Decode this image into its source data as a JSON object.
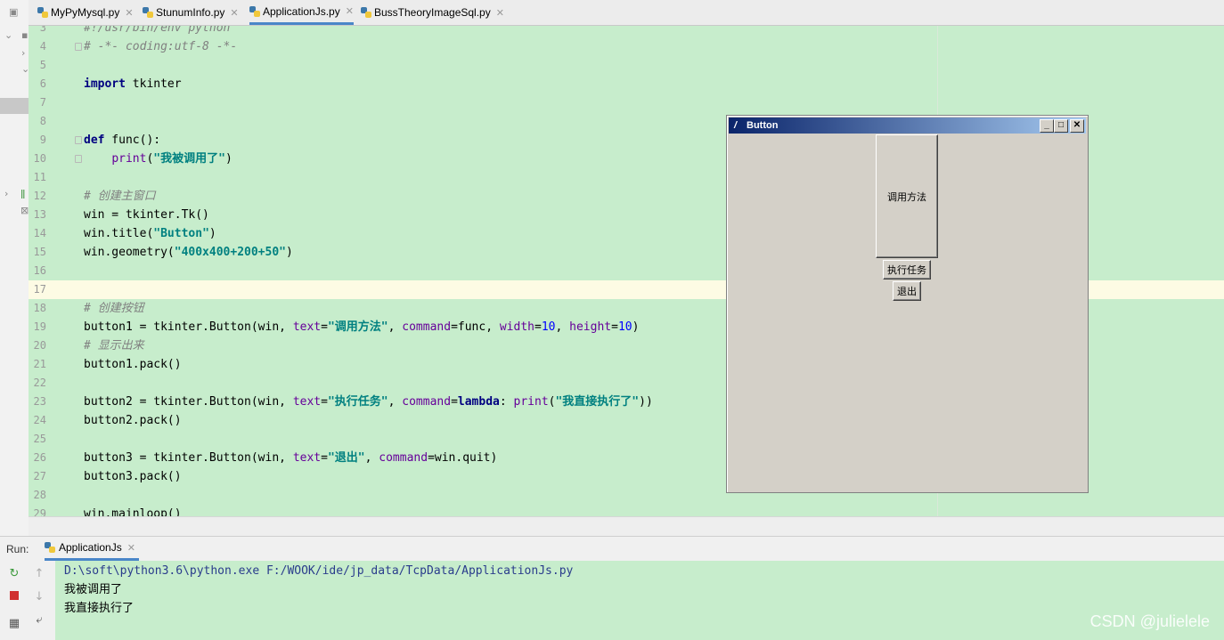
{
  "tabs": [
    {
      "label": "MyPyMysql.py",
      "active": false
    },
    {
      "label": "StunumInfo.py",
      "active": false
    },
    {
      "label": "ApplicationJs.py",
      "active": true
    },
    {
      "label": "BussTheoryImageSql.py",
      "active": false
    }
  ],
  "editor": {
    "lines": [
      {
        "n": "3",
        "html": "<span class=\"cm\">#!/usr/bin/env python</span>"
      },
      {
        "n": "4",
        "html": "<span class=\"cm\"># -*- coding:utf-8 -*-</span>"
      },
      {
        "n": "5",
        "html": ""
      },
      {
        "n": "6",
        "html": "<span class=\"kw\">import</span> tkinter"
      },
      {
        "n": "7",
        "html": ""
      },
      {
        "n": "8",
        "html": ""
      },
      {
        "n": "9",
        "html": "<span class=\"kw\">def</span> func():"
      },
      {
        "n": "10",
        "html": "    <span class=\"par\">print</span>(<span class=\"str\">\"我被调用了\"</span>)"
      },
      {
        "n": "11",
        "html": ""
      },
      {
        "n": "12",
        "html": "<span class=\"cm\"># 创建主窗口</span>"
      },
      {
        "n": "13",
        "html": "win = tkinter.Tk()"
      },
      {
        "n": "14",
        "html": "win.title(<span class=\"str\">\"Button\"</span>)"
      },
      {
        "n": "15",
        "html": "win.geometry(<span class=\"str\">\"400x400+200+50\"</span>)"
      },
      {
        "n": "16",
        "html": ""
      },
      {
        "n": "17",
        "html": "",
        "current": true
      },
      {
        "n": "18",
        "html": "<span class=\"cm\"># 创建按钮</span>"
      },
      {
        "n": "19",
        "html": "button1 = tkinter.Button(win, <span class=\"par\">text</span>=<span class=\"str\">\"调用方法\"</span>, <span class=\"par\">command</span>=func, <span class=\"par\">width</span>=<span class=\"num\">10</span>, <span class=\"par\">height</span>=<span class=\"num\">10</span>)"
      },
      {
        "n": "20",
        "html": "<span class=\"cm\"># 显示出来</span>"
      },
      {
        "n": "21",
        "html": "button1.pack()"
      },
      {
        "n": "22",
        "html": ""
      },
      {
        "n": "23",
        "html": "button2 = tkinter.Button(win, <span class=\"par\">text</span>=<span class=\"str\">\"执行任务\"</span>, <span class=\"par\">command</span>=<span class=\"kw\">lambda</span>: <span class=\"par\">print</span>(<span class=\"str\">\"我直接执行了\"</span>))"
      },
      {
        "n": "24",
        "html": "button2.pack()"
      },
      {
        "n": "25",
        "html": ""
      },
      {
        "n": "26",
        "html": "button3 = tkinter.Button(win, <span class=\"par\">text</span>=<span class=\"str\">\"退出\"</span>, <span class=\"par\">command</span>=win.quit)"
      },
      {
        "n": "27",
        "html": "button3.pack()"
      },
      {
        "n": "28",
        "html": ""
      },
      {
        "n": "29",
        "html": "win.mainloop()"
      }
    ]
  },
  "run": {
    "label": "Run:",
    "tab_label": "ApplicationJs",
    "console_lines": [
      {
        "text": "D:\\soft\\python3.6\\python.exe F:/WOOK/ide/jp_data/TcpData/ApplicationJs.py",
        "color": "#2a3c8c"
      },
      {
        "text": "我被调用了",
        "color": "#000000"
      },
      {
        "text": "我直接执行了",
        "color": "#000000"
      }
    ]
  },
  "tk_window": {
    "title": "Button",
    "button1": "调用方法",
    "button2": "执行任务",
    "button3": "退出"
  },
  "watermark": "CSDN @julielele"
}
